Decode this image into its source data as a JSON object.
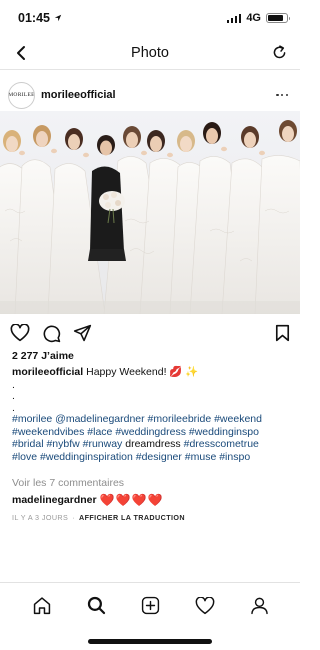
{
  "status": {
    "time": "01:45",
    "network": "4G",
    "battery_level": 0.85
  },
  "nav": {
    "title": "Photo",
    "back_icon": "chevron-left-icon",
    "refresh_icon": "refresh-icon"
  },
  "post": {
    "avatar_text": "MORILEE",
    "username": "morileeofficial",
    "photo_alt": "Brides in white gowns blowing kisses with a woman in a black dress holding a bouquet",
    "likes": "2 277 J’aime",
    "caption": {
      "username": "morileeofficial",
      "text": "Happy Weekend! 💋 ✨",
      "dots": [
        ".",
        ".",
        "."
      ],
      "hashtags": [
        "#morilee @madelinegardner #morileebride #weekend",
        "#weekendvibes #lace #weddingdress #weddinginspo",
        "#bridal #nybfw #runway"
      ],
      "plain_word": "dreamdress",
      "hashtags_tail_1": "#dresscometrue",
      "hashtags_tail_2": "#love #weddinginspiration #designer #muse #inspo"
    },
    "view_comments": "Voir les 7 commentaires",
    "comment": {
      "username": "madelinegardner",
      "text": "❤️❤️❤️❤️"
    },
    "time_ago": "IL Y A 3 JOURS",
    "translate": "AFFICHER LA TRADUCTION"
  },
  "colors": {
    "hashtag": "#1a4a7a",
    "heart": "#e0202a",
    "muted": "#8e8e8e"
  }
}
